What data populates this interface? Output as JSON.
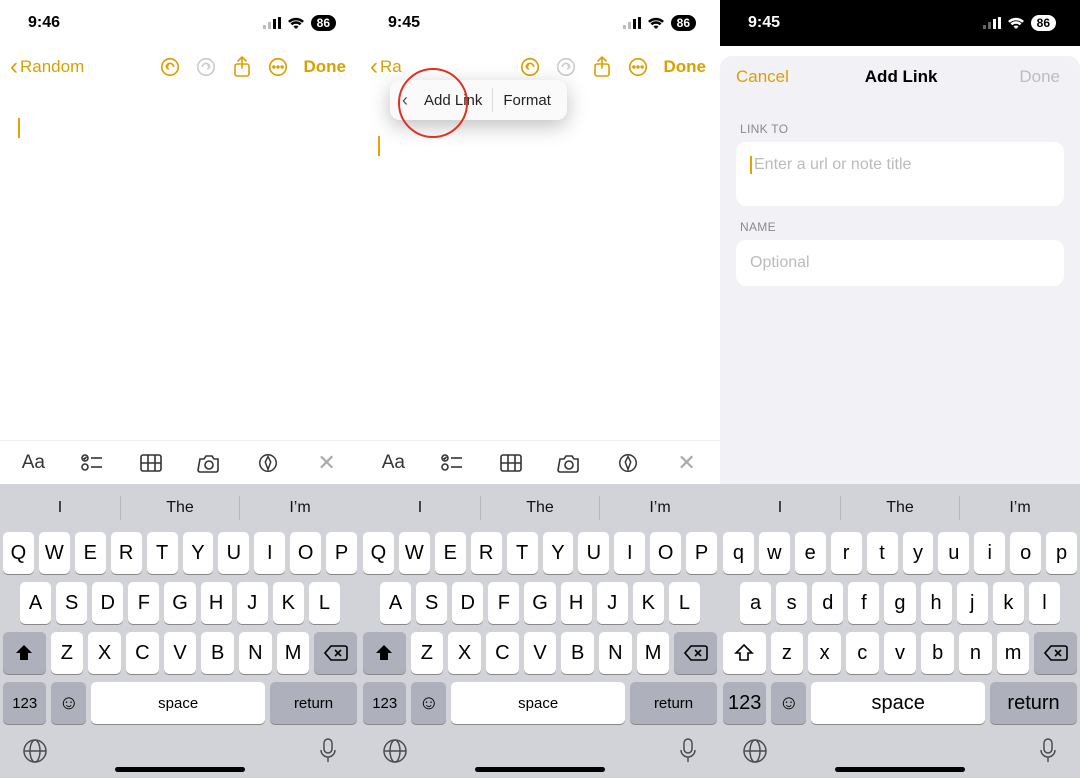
{
  "status": {
    "time1": "9:46",
    "time2": "9:45",
    "time3": "9:45",
    "battery": "86"
  },
  "nav": {
    "back_label": "Random",
    "back_short": "Ra",
    "done": "Done"
  },
  "note": {
    "apple": ""
  },
  "context_menu": {
    "add_link": "Add Link",
    "format": "Format"
  },
  "modal": {
    "cancel": "Cancel",
    "title": "Add Link",
    "done": "Done",
    "section_linkto": "LINK TO",
    "placeholder_linkto": "Enter a url or note title",
    "section_name": "NAME",
    "placeholder_name": "Optional"
  },
  "toolbar": {
    "aa": "Aa"
  },
  "suggestions": {
    "s1": "I",
    "s2": "The",
    "s3": "I’m"
  },
  "keys_upper": {
    "r1": [
      "Q",
      "W",
      "E",
      "R",
      "T",
      "Y",
      "U",
      "I",
      "O",
      "P"
    ],
    "r2": [
      "A",
      "S",
      "D",
      "F",
      "G",
      "H",
      "J",
      "K",
      "L"
    ],
    "r3": [
      "Z",
      "X",
      "C",
      "V",
      "B",
      "N",
      "M"
    ]
  },
  "keys_lower": {
    "r1": [
      "q",
      "w",
      "e",
      "r",
      "t",
      "y",
      "u",
      "i",
      "o",
      "p"
    ],
    "r2": [
      "a",
      "s",
      "d",
      "f",
      "g",
      "h",
      "j",
      "k",
      "l"
    ],
    "r3": [
      "z",
      "x",
      "c",
      "v",
      "b",
      "n",
      "m"
    ]
  },
  "keys_labels": {
    "n123": "123",
    "space": "space",
    "return": "return"
  }
}
